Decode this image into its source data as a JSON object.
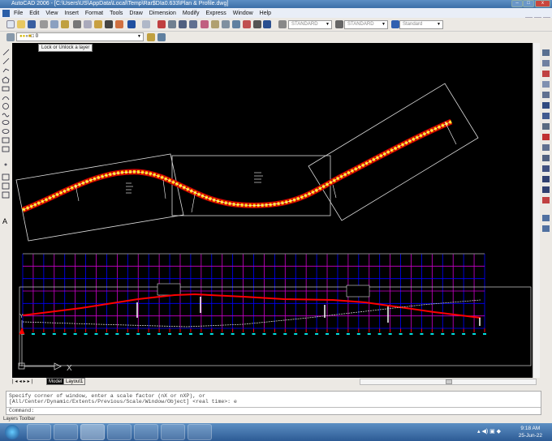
{
  "window": {
    "title": "AutoCAD 2006 - [C:\\Users\\US\\AppData\\Local\\Temp\\Rar$DIa0.633\\Plan & Profile.dwg]"
  },
  "menu": [
    "File",
    "Edit",
    "View",
    "Insert",
    "Format",
    "Tools",
    "Draw",
    "Dimension",
    "Modify",
    "Express",
    "Window",
    "Help"
  ],
  "styles": {
    "text_style": "STANDARD",
    "dim_style": "STANDARD",
    "table_style": "Standard"
  },
  "layer": {
    "current": "0"
  },
  "tooltip": "Lock or Unlock a layer",
  "tabs": [
    "Model",
    "Layout1"
  ],
  "ucs": {
    "x": "X",
    "y": "Y"
  },
  "command": {
    "history": [
      "Specify corner of window, enter a scale factor (nX or nXP), or",
      "[All/Center/Dynamic/Extents/Previous/Scale/Window/Object] <real time>: e"
    ],
    "prompt": "Command:"
  },
  "status": "Layers Toolbar",
  "clock": {
    "time": "9:18 AM",
    "date": "25-Jun-22"
  },
  "colors": {
    "profile": "#ff0000",
    "grid_blue": "#0000ff",
    "grid_magenta": "#cc00cc",
    "road": "#ffd400",
    "cyan": "#00e0e0"
  }
}
